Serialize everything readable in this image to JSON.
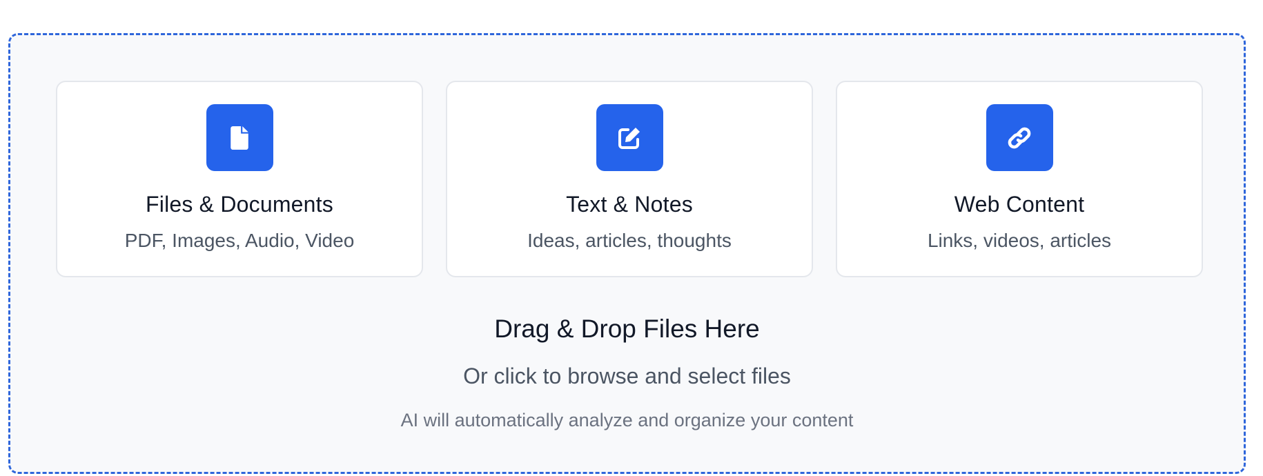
{
  "upload_area": {
    "cards": [
      {
        "icon": "file-icon",
        "title": "Files & Documents",
        "subtitle": "PDF, Images, Audio, Video"
      },
      {
        "icon": "edit-icon",
        "title": "Text & Notes",
        "subtitle": "Ideas, articles, thoughts"
      },
      {
        "icon": "link-icon",
        "title": "Web Content",
        "subtitle": "Links, videos, articles"
      }
    ],
    "title": "Drag & Drop Files Here",
    "subtitle": "Or click to browse and select files",
    "note": "AI will automatically analyze and organize your content"
  },
  "colors": {
    "accent": "#2563eb",
    "dashed_border": "#2f66db",
    "background": "#f8f9fb",
    "card_border": "#e4e7ec"
  }
}
